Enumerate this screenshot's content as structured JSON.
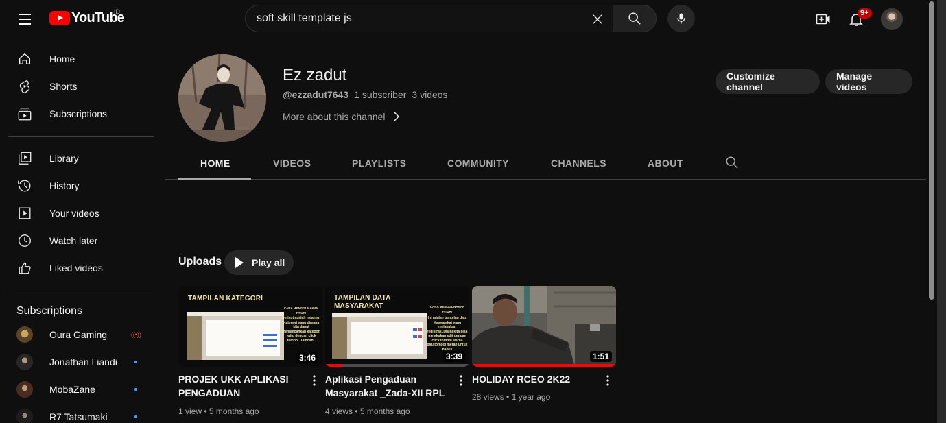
{
  "topbar": {
    "logo_text": "YouTube",
    "country_code": "ID",
    "search_value": "soft skill template js",
    "notification_count": "9+"
  },
  "sidebar": {
    "main": [
      {
        "label": "Home",
        "icon": "home-icon"
      },
      {
        "label": "Shorts",
        "icon": "shorts-icon"
      },
      {
        "label": "Subscriptions",
        "icon": "subscriptions-icon"
      }
    ],
    "library": [
      {
        "label": "Library",
        "icon": "library-icon"
      },
      {
        "label": "History",
        "icon": "history-icon"
      },
      {
        "label": "Your videos",
        "icon": "your-videos-icon"
      },
      {
        "label": "Watch later",
        "icon": "watch-later-icon"
      },
      {
        "label": "Liked videos",
        "icon": "liked-videos-icon"
      }
    ],
    "subscriptions_heading": "Subscriptions",
    "subscriptions": [
      {
        "label": "Oura Gaming",
        "status": "live"
      },
      {
        "label": "Jonathan Liandi",
        "status": "new"
      },
      {
        "label": "MobaZane",
        "status": "new"
      },
      {
        "label": "R7 Tatsumaki",
        "status": "new"
      }
    ]
  },
  "channel": {
    "name": "Ez zadut",
    "handle": "@ezzadut7643",
    "subscribers": "1 subscriber",
    "videos_count": "3 videos",
    "more_about": "More about this channel",
    "customize_label": "Customize channel",
    "manage_label": "Manage videos"
  },
  "tabs": [
    "HOME",
    "VIDEOS",
    "PLAYLISTS",
    "COMMUNITY",
    "CHANNELS",
    "ABOUT"
  ],
  "active_tab": "HOME",
  "uploads": {
    "title": "Uploads",
    "play_all_label": "Play all",
    "videos": [
      {
        "title": "PROJEK UKK APLIKASI PENGADUAN MASYARAKAT...",
        "duration": "3:46",
        "views": "1 view",
        "age": "5 months ago",
        "thumb_heading": "TAMPILAN KATEGORI",
        "thumb_side_title": "CARA MENGGUNAKAN FITUR!",
        "thumb_side_text": "Berikut adalah halaman Kategori yang dimana kita dapat menambahkan kategori yaitu dengan click tombol 'Tambah'."
      },
      {
        "title": "Aplikasi Pengaduan Masyarakat _Zada-XII RPL",
        "duration": "3:39",
        "views": "4 views",
        "age": "5 months ago",
        "watched_fraction": 0.12,
        "thumb_heading": "TAMPILAN DATA MASYARAKAT",
        "thumb_side_title": "CARA MENGGUNAKAN FITUR!",
        "thumb_side_text": "Ini adalah tampilan data Masyarakat yang melakukan registrasi.Disini kita bisa melakukan edit dengan click tombol warna biru,tombol merah untuk hapus"
      },
      {
        "title": "HOLIDAY RCEO 2K22",
        "duration": "1:51",
        "views": "28 views",
        "age": "1 year ago",
        "watched_fraction": 1.0
      }
    ]
  },
  "colors": {
    "background": "#0f0f0f",
    "accent_red": "#ff0000",
    "subscription_dot": "#3ea6ff",
    "thumb_brown": "#8b7a5a"
  }
}
